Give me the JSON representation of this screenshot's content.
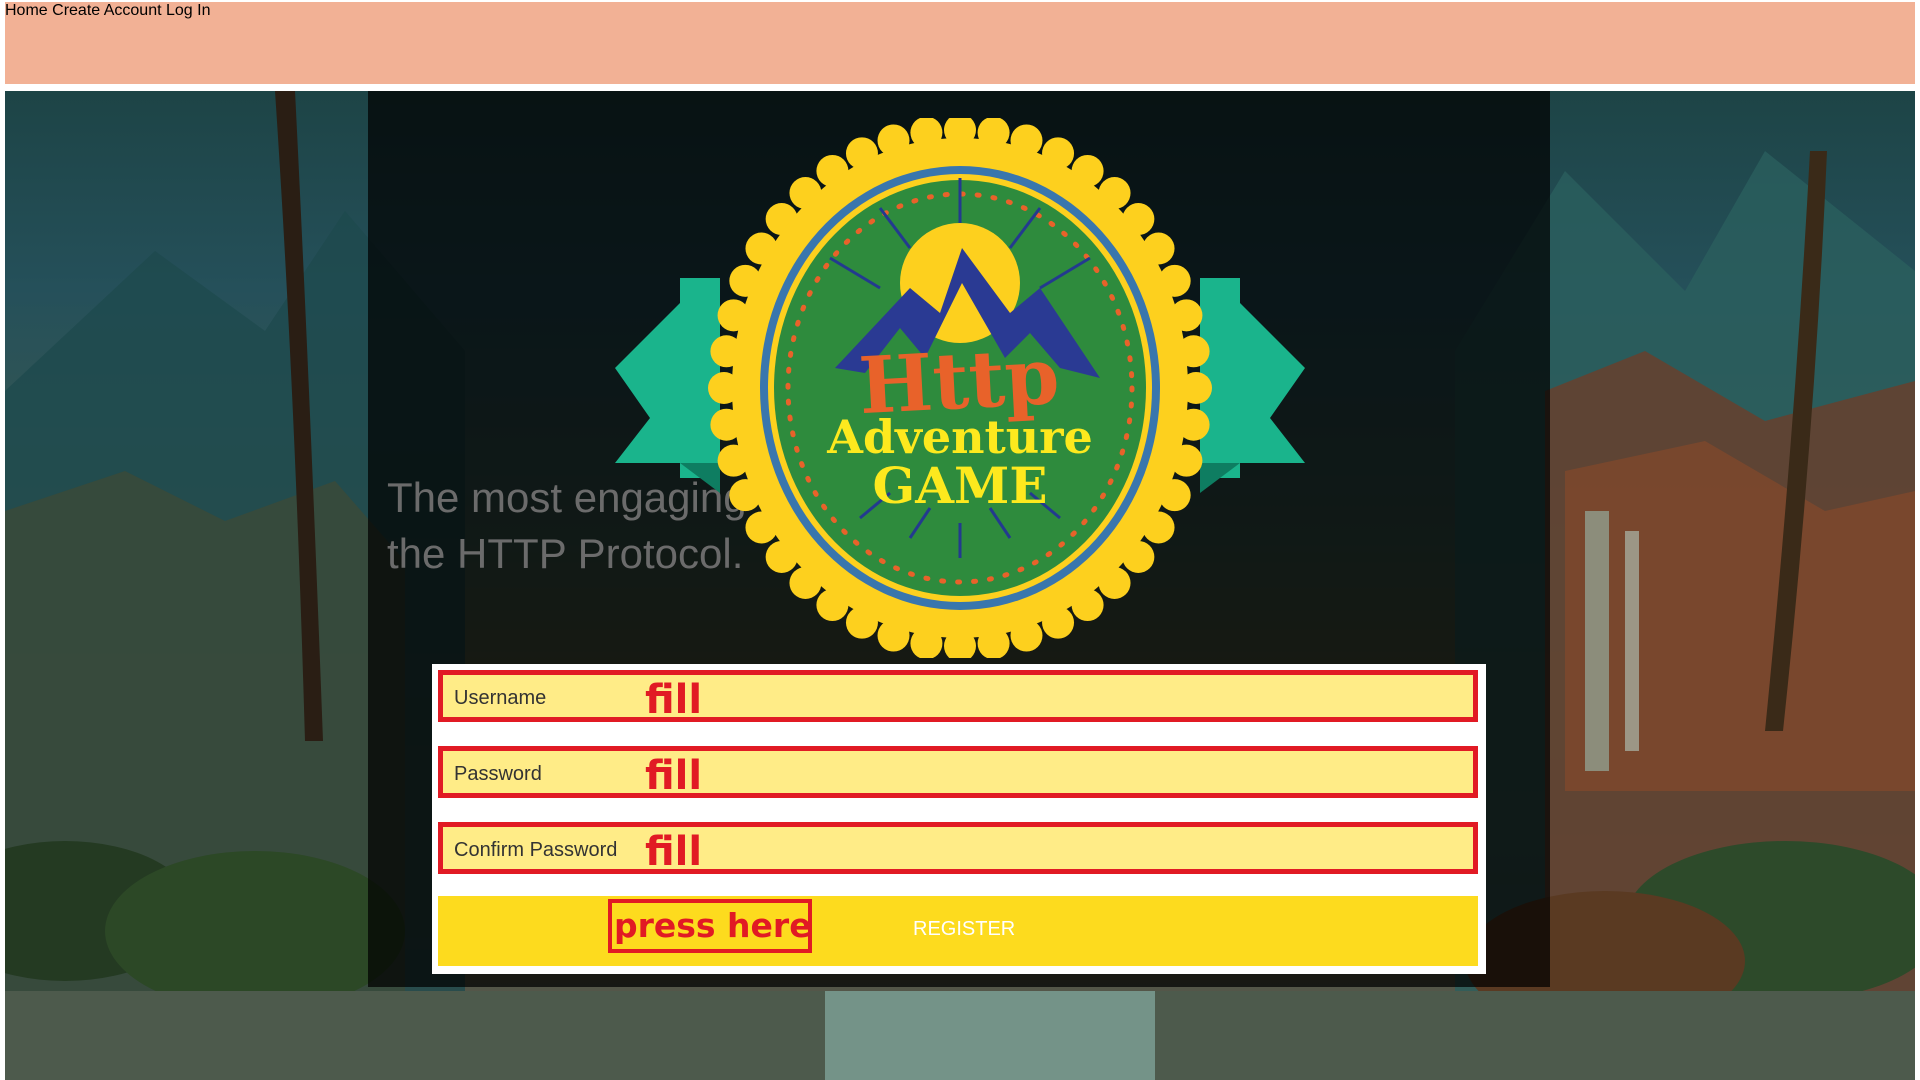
{
  "nav": {
    "home": "Home",
    "create_account": "Create Account",
    "log_in": "Log In"
  },
  "hero": {
    "tagline_line1": "The most engaging g",
    "tagline_line2": "the HTTP Protocol."
  },
  "logo": {
    "word1": "Http",
    "word2": "Adventure",
    "word3": "GAME"
  },
  "form": {
    "username_label": "Username",
    "password_label": "Password",
    "confirm_label": "Confirm Password",
    "fill_hint": "fill",
    "register_label": "REGISTER",
    "press_hint": "press here after"
  },
  "colors": {
    "topbar": "#f2b195",
    "field_bg": "#ffec87",
    "annotation_red": "#e11a24",
    "button_yellow": "#fddb1e"
  }
}
